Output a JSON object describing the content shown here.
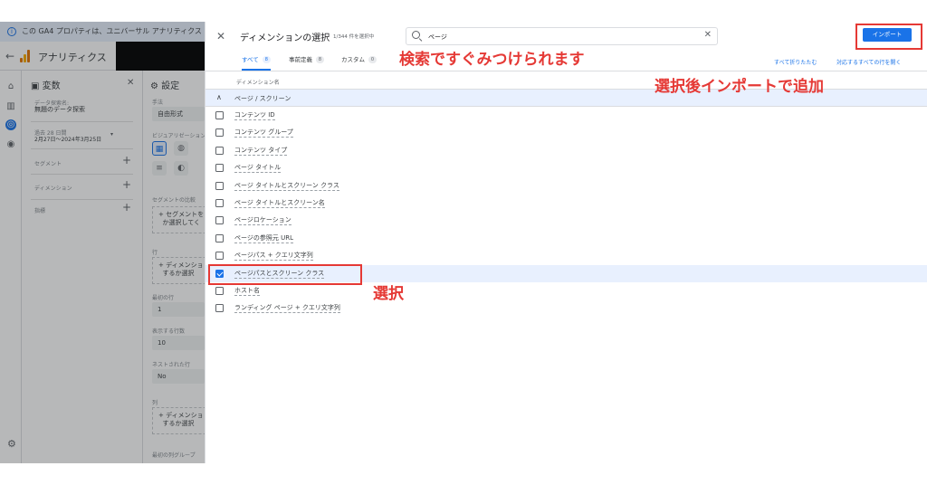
{
  "banner": {
    "text": "この GA4 プロパティは、ユニバーサル アナリティクス プロパティ"
  },
  "app": {
    "title": "アナリティクス"
  },
  "rail": {
    "icons": [
      "home-icon",
      "reports-icon",
      "explore-icon",
      "advertising-icon",
      "settings-icon"
    ]
  },
  "variables_panel": {
    "title": "変数",
    "exploration_name_label": "データ探索名:",
    "exploration_name": "無題のデータ探索",
    "date_caption": "過去 28 日間",
    "date_range": "2月27日～2024年3月25日",
    "sections": [
      "セグメント",
      "ディメンション",
      "指標"
    ]
  },
  "settings_panel": {
    "title": "設定",
    "technique_label": "手法",
    "technique_value": "自由形式",
    "viz_label": "ビジュアリゼーション",
    "segment_compare_label": "セグメントの比較",
    "segment_drop_text": "セグメントを",
    "segment_drop_text2": "か選択してく",
    "rows_label": "行",
    "rows_drop_text": "ディメンショ",
    "rows_drop_text2": "するか選択",
    "start_row_label": "最初の行",
    "start_row_value": "1",
    "show_rows_label": "表示する行数",
    "show_rows_value": "10",
    "nested_rows_label": "ネストされた行",
    "nested_rows_value": "No",
    "cols_label": "列",
    "cols_drop_text": "ディメンショ",
    "cols_drop_text2": "するか選択",
    "first_col_group_label": "最初の列グループ"
  },
  "dialog": {
    "title": "ディメンションの選択",
    "subtitle": "1/344 件を選択中",
    "search": {
      "value": "ページ",
      "placeholder": ""
    },
    "import_label": "インポート",
    "tabs": [
      {
        "label": "すべて",
        "count": "8"
      },
      {
        "label": "事前定義",
        "count": "8"
      },
      {
        "label": "カスタム",
        "count": "0"
      }
    ],
    "collapse_all": "すべて折りたたむ",
    "open_matching": "対応するすべての行を開く",
    "column_header": "ディメンション名",
    "group_label": "ページ / スクリーン",
    "rows": [
      {
        "label": "コンテンツ ID",
        "checked": false
      },
      {
        "label": "コンテンツ グループ",
        "checked": false
      },
      {
        "label": "コンテンツ タイプ",
        "checked": false
      },
      {
        "label": "ページ タイトル",
        "checked": false
      },
      {
        "label": "ページ タイトルとスクリーン クラス",
        "checked": false
      },
      {
        "label": "ページ タイトルとスクリーン名",
        "checked": false
      },
      {
        "label": "ページロケーション",
        "checked": false
      },
      {
        "label": "ページの参照元 URL",
        "checked": false
      },
      {
        "label": "ページパス + クエリ文字列",
        "checked": false
      },
      {
        "label": "ページパスとスクリーン クラス",
        "checked": true
      },
      {
        "label": "ホスト名",
        "checked": false
      },
      {
        "label": "ランディング ページ + クエリ文字列",
        "checked": false
      }
    ]
  },
  "annotations": {
    "search": "検索ですぐみつけられます",
    "import": "選択後インポートで追加",
    "select": "選択"
  },
  "colors": {
    "accent": "#1a73e8",
    "annotation": "#e53935",
    "selected_row": "#e8f0fe"
  }
}
